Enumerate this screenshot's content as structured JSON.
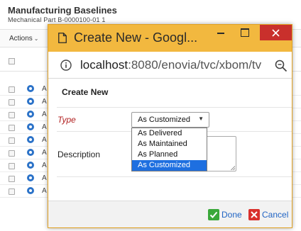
{
  "background": {
    "title": "Manufacturing Baselines",
    "subtitle": "Mechanical Part B-0000100-01 1",
    "toolbar": {
      "actions_label": "Actions"
    },
    "rows": [
      {
        "text": "A"
      },
      {
        "text": "A"
      },
      {
        "text": "A"
      },
      {
        "text": "A"
      },
      {
        "text": "A"
      },
      {
        "text": "A"
      },
      {
        "text": "A"
      },
      {
        "text": "A"
      },
      {
        "text": "A"
      }
    ]
  },
  "popup": {
    "window_title": "Create New - Googl...",
    "url_host": "localhost",
    "url_rest": ":8080/enovia/tvc/xbom/tv",
    "form_title": "Create New",
    "type_label": "Type",
    "type_value": "As Customized",
    "type_options": [
      "As Delivered",
      "As Maintained",
      "As Planned",
      "As Customized"
    ],
    "selected_option_index": 3,
    "description_label": "Description",
    "description_value": "",
    "done_label": "Done",
    "cancel_label": "Cancel"
  },
  "colors": {
    "titlebar": "#f2b83f",
    "close_button": "#c9302c",
    "required_label": "#b22222",
    "selection": "#1e6fe0",
    "link": "#2164c4"
  }
}
